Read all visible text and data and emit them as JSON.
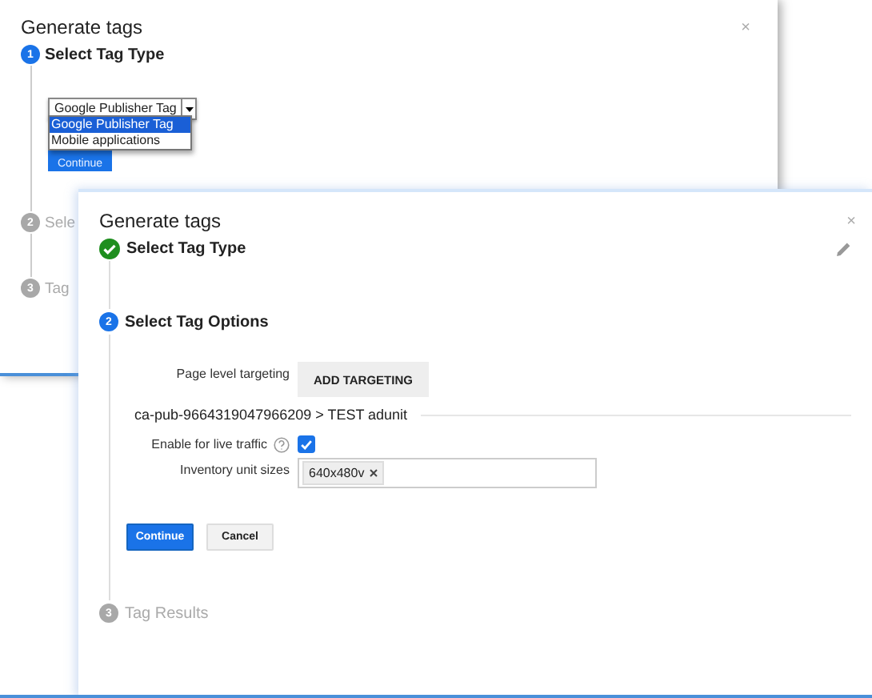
{
  "back_dialog": {
    "title": "Generate tags",
    "close": "×",
    "steps": [
      {
        "number": "1",
        "label": "Select Tag Type",
        "completed": false,
        "current": true
      },
      {
        "number": "2",
        "label": "Sele",
        "completed": false,
        "current": false
      },
      {
        "number": "3",
        "label": "Tag",
        "completed": false,
        "current": false
      }
    ],
    "tag_type_select": {
      "value": "Google Publisher Tag",
      "expanded": true,
      "options": [
        {
          "label": "Google Publisher Tag",
          "selected": true
        },
        {
          "label": "Mobile applications",
          "selected": false
        }
      ]
    },
    "continue_button": "Continue"
  },
  "front_dialog": {
    "title": "Generate tags",
    "close": "×",
    "steps": [
      {
        "label": "Select Tag Type",
        "completed": true,
        "current": false
      },
      {
        "number": "2",
        "label": "Select Tag Options",
        "completed": false,
        "current": true
      },
      {
        "number": "3",
        "label": "Tag Results",
        "completed": false,
        "current": false
      }
    ],
    "page_level_targeting": {
      "label": "Page level targeting",
      "button": "ADD TARGETING"
    },
    "ad_unit": "ca-pub-9664319047966209 > TEST adunit",
    "live_traffic": {
      "label": "Enable for live traffic",
      "checked": true
    },
    "inventory_sizes": {
      "label": "Inventory unit sizes",
      "chips": [
        {
          "label": "640x480v"
        }
      ]
    },
    "buttons": [
      {
        "label": "Continue",
        "kind": "primary"
      },
      {
        "label": "Cancel",
        "kind": "secondary"
      }
    ]
  }
}
